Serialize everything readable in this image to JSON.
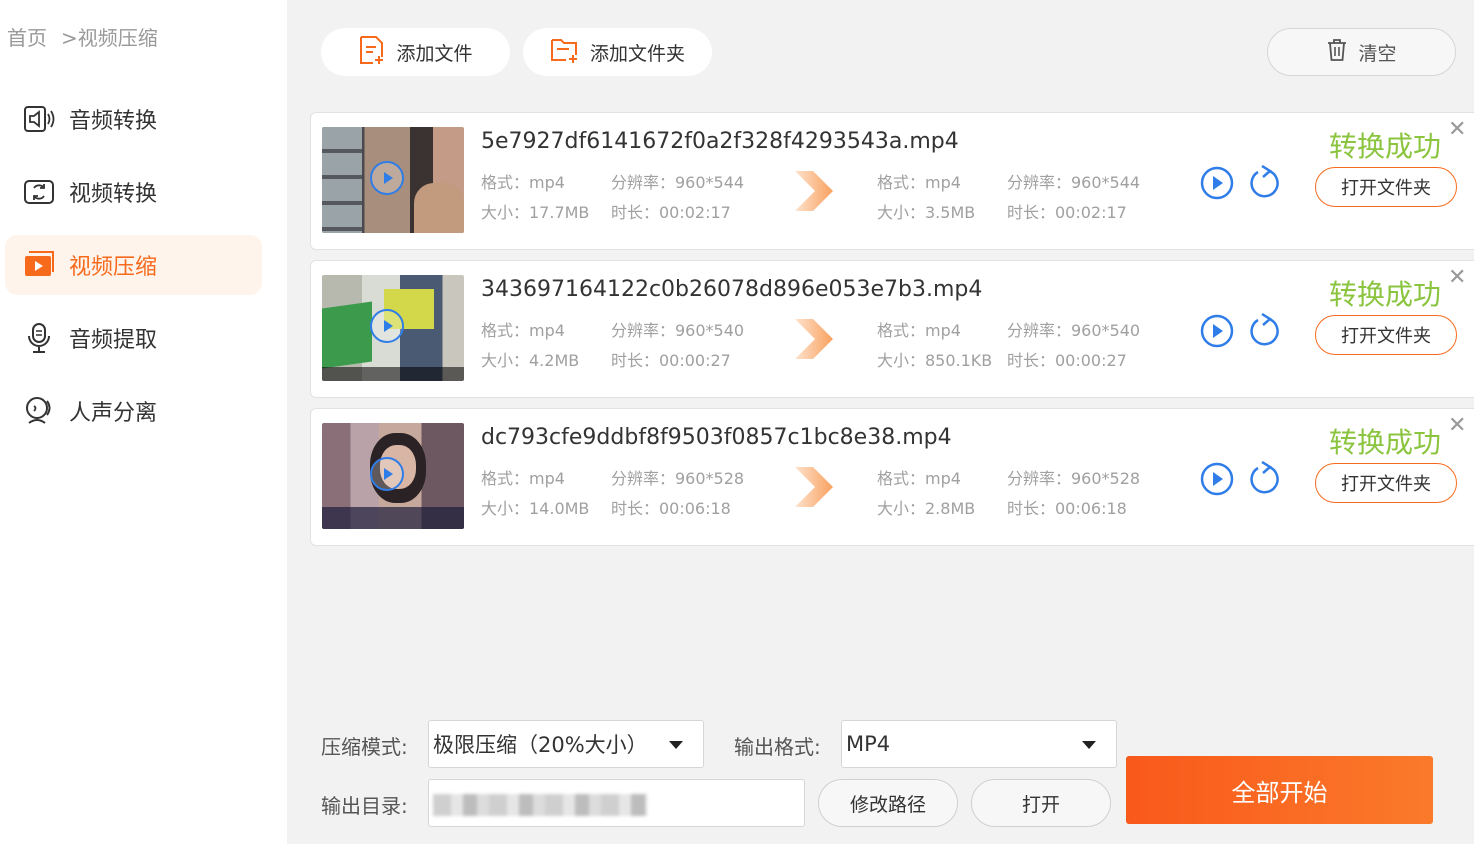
{
  "breadcrumb": {
    "home": "首页",
    "current": ">视频压缩"
  },
  "sidebar": {
    "items": [
      {
        "label": "音频转换",
        "icon": "audio-convert-icon"
      },
      {
        "label": "视频转换",
        "icon": "video-convert-icon"
      },
      {
        "label": "视频压缩",
        "icon": "video-compress-icon",
        "active": true
      },
      {
        "label": "音频提取",
        "icon": "audio-extract-icon"
      },
      {
        "label": "人声分离",
        "icon": "vocal-separate-icon"
      }
    ]
  },
  "toolbar": {
    "add_file": "添加文件",
    "add_folder": "添加文件夹",
    "clear": "清空"
  },
  "files": [
    {
      "name": "5e7927df6141672f0a2f328f4293543a.mp4",
      "src_format": "格式：mp4",
      "src_resolution": "分辨率：960*544",
      "src_size": "大小：17.7MB",
      "src_duration": "时长：00:02:17",
      "dst_format": "格式：mp4",
      "dst_resolution": "分辨率：960*544",
      "dst_size": "大小：3.5MB",
      "dst_duration": "时长：00:02:17",
      "status": "转换成功",
      "open_label": "打开文件夹"
    },
    {
      "name": "343697164122c0b26078d896e053e7b3.mp4",
      "src_format": "格式：mp4",
      "src_resolution": "分辨率：960*540",
      "src_size": "大小：4.2MB",
      "src_duration": "时长：00:00:27",
      "dst_format": "格式：mp4",
      "dst_resolution": "分辨率：960*540",
      "dst_size": "大小：850.1KB",
      "dst_duration": "时长：00:00:27",
      "status": "转换成功",
      "open_label": "打开文件夹"
    },
    {
      "name": "dc793cfe9ddbf8f9503f0857c1bc8e38.mp4",
      "src_format": "格式：mp4",
      "src_resolution": "分辨率：960*528",
      "src_size": "大小：14.0MB",
      "src_duration": "时长：00:06:18",
      "dst_format": "格式：mp4",
      "dst_resolution": "分辨率：960*528",
      "dst_size": "大小：2.8MB",
      "dst_duration": "时长：00:06:18",
      "status": "转换成功",
      "open_label": "打开文件夹"
    }
  ],
  "controls": {
    "mode_label": "压缩模式:",
    "mode_value": "极限压缩（20%大小）",
    "format_label": "输出格式:",
    "format_value": "MP4",
    "dir_label": "输出目录:",
    "change_path": "修改路径",
    "open": "打开",
    "start_all": "全部开始"
  },
  "colors": {
    "accent": "#f76a1b",
    "success": "#8bc43f",
    "play": "#2f7de8"
  }
}
